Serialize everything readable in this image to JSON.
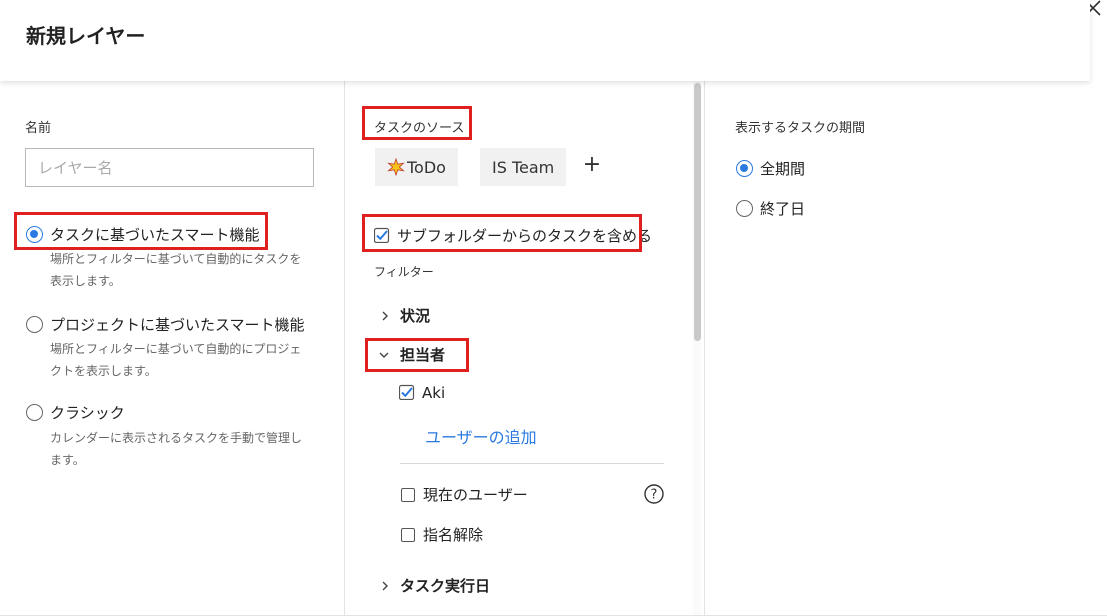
{
  "header": {
    "title": "新規レイヤー"
  },
  "left": {
    "name_label": "名前",
    "name_placeholder": "レイヤー名",
    "options": [
      {
        "label": "タスクに基づいたスマート機能",
        "desc1": "場所とフィルターに基づいて自動的にタスクを",
        "desc2": "表示します。",
        "checked": true
      },
      {
        "label": "プロジェクトに基づいたスマート機能",
        "desc1": "場所とフィルターに基づいて自動的にプロジェ",
        "desc2": "クトを表示します。",
        "checked": false
      },
      {
        "label": "クラシック",
        "desc1": "カレンダーに表示されるタスクを手動で管理し",
        "desc2": "ます。",
        "checked": false
      }
    ]
  },
  "middle": {
    "source_label": "タスクのソース",
    "sources": [
      {
        "label": "ToDo",
        "icon": "sparkle-star-icon"
      },
      {
        "label": "IS Team"
      }
    ],
    "add_label": "+",
    "include_subfolders": "サブフォルダーからのタスクを含める",
    "filter_label": "フィルター",
    "groups": {
      "status": "状況",
      "assignee": "担当者",
      "due": "タスク実行日"
    },
    "assignee_items": {
      "aki": "Aki",
      "add_user": "ユーザーの追加",
      "current_user": "現在のユーザー",
      "unassigned": "指名解除"
    },
    "help_symbol": "?"
  },
  "right": {
    "period_label": "表示するタスクの期間",
    "options": [
      {
        "label": "全期間",
        "checked": true
      },
      {
        "label": "終了日",
        "checked": false
      }
    ]
  },
  "colors": {
    "accent": "#2a7ae2",
    "highlight": "#e0201f"
  }
}
